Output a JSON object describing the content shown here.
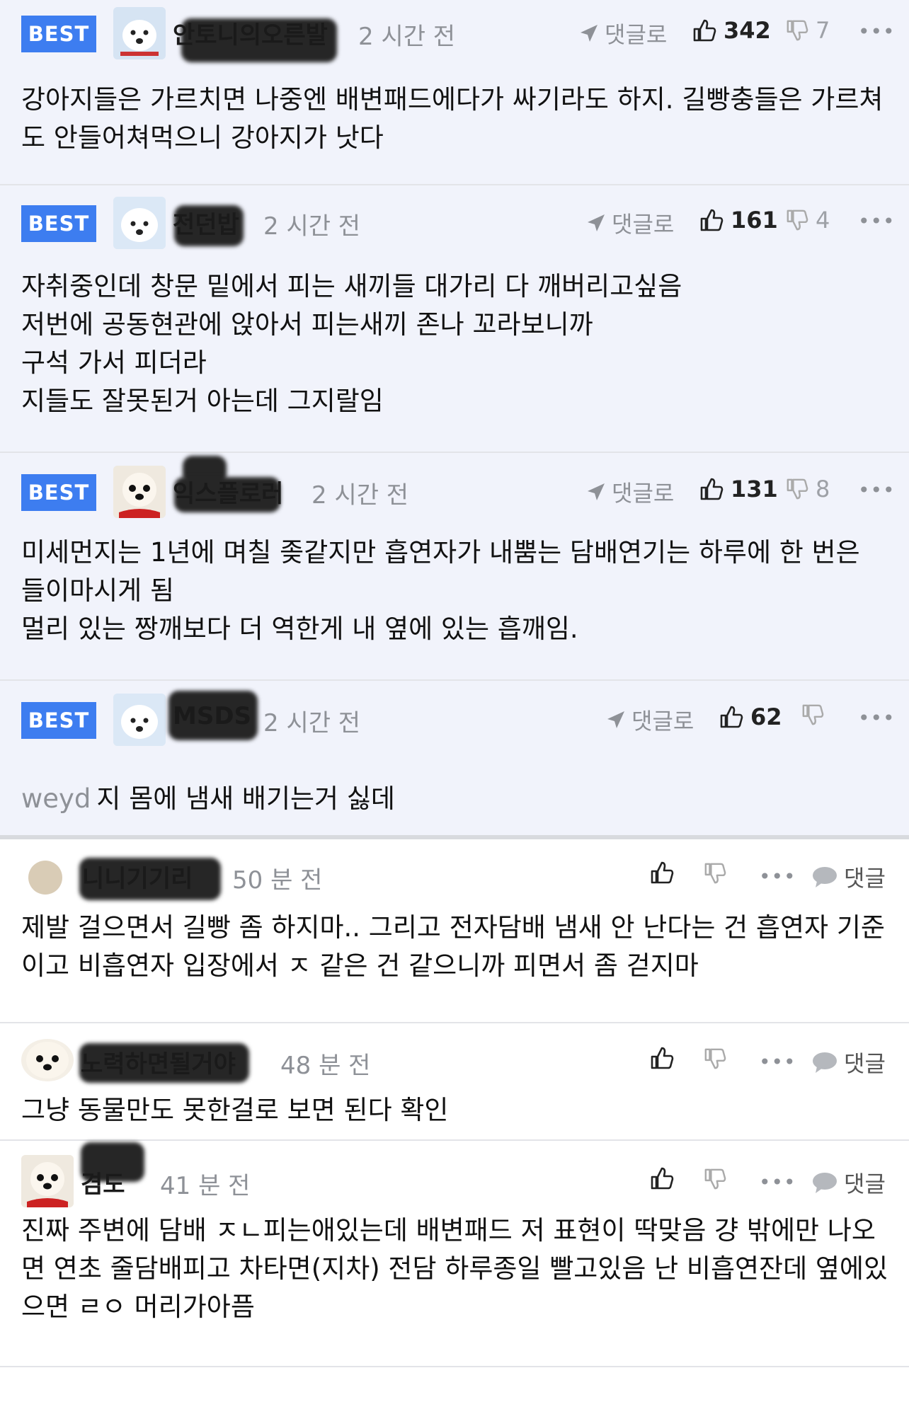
{
  "best_comments": [
    {
      "badge": "BEST",
      "nickname": "안토니의오른발",
      "time": "2 시간 전",
      "reply_label": "댓글로",
      "likes": "342",
      "dislikes": "7",
      "more": "•••",
      "text": "강아지들은 가르치면 나중엔 배변패드에다가 싸기라도 하지. 길빵충들은 가르쳐도 안들어쳐먹으니 강아지가 낫다"
    },
    {
      "badge": "BEST",
      "nickname": "전던밥",
      "time": "2 시간 전",
      "reply_label": "댓글로",
      "likes": "161",
      "dislikes": "4",
      "more": "•••",
      "text": "자취중인데 창문 밑에서 피는 새끼들 대가리 다 깨버리고싶음\n저번에 공동현관에 앉아서 피는새끼 존나 꼬라보니까\n구석 가서 피더라\n지들도 잘못된거 아는데 그지랄임"
    },
    {
      "badge": "BEST",
      "nickname": "익스플로러",
      "time": "2 시간 전",
      "reply_label": "댓글로",
      "likes": "131",
      "dislikes": "8",
      "more": "•••",
      "text": "미세먼지는 1년에 며칠 좆같지만 흡연자가 내뿜는 담배연기는 하루에 한 번은 들이마시게 됨\n멀리 있는 짱깨보다 더 역한게 내 옆에 있는 흡깨임."
    },
    {
      "badge": "BEST",
      "nickname": "MSDS",
      "time": "2 시간 전",
      "reply_label": "댓글로",
      "likes": "62",
      "dislikes": "",
      "more": "•••",
      "mention": "weyd",
      "text": "지 몸에 냄새 배기는거 싫데"
    }
  ],
  "comments": [
    {
      "nickname": "니니기기리",
      "time": "50 분 전",
      "more": "•••",
      "reply_label": "댓글",
      "text": "제발 걸으면서 길빵 좀 하지마.. 그리고 전자담배 냄새 안 난다는 건 흡연자 기준이고 비흡연자 입장에서 ㅈ 같은 건 같으니까 피면서 좀 걷지마"
    },
    {
      "nickname": "노력하면될거야",
      "time": "48 분 전",
      "more": "•••",
      "reply_label": "댓글",
      "text": "그냥 동물만도 못한걸로 보면 된다 확인"
    },
    {
      "nickname": "겸도",
      "time": "41 분 전",
      "more": "•••",
      "reply_label": "댓글",
      "text": "진짜 주변에 담배 ㅈㄴ피는애있는데 배변패드 저 표현이 딱맞음 걍 밖에만 나오면 연초 줄담배피고 차타면(지차) 전담 하루종일 빨고있음 난 비흡연잔데 옆에있으면 ㄹㅇ 머리가아픔"
    }
  ],
  "colors": {
    "badge": "#3d7df0",
    "best_bg": "#f1f3fb",
    "muted": "#8e9197"
  }
}
